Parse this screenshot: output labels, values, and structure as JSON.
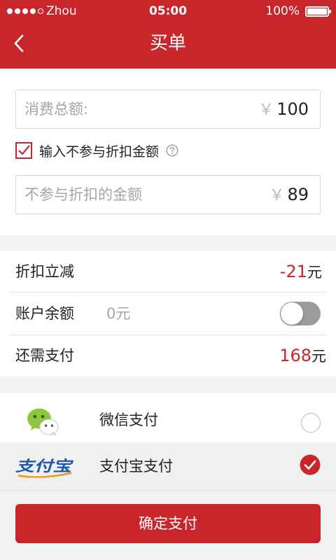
{
  "status_bar": {
    "carrier": "Zhou",
    "time": "05:00",
    "battery": "100%"
  },
  "nav": {
    "title": "买单"
  },
  "amount_form": {
    "total_field": {
      "label": "消费总额:",
      "currency": "￥",
      "value": "100"
    },
    "exclude_checkbox": {
      "label": "输入不参与折扣金额",
      "checked": true
    },
    "exclude_field": {
      "placeholder": "不参与折扣的金额",
      "currency": "￥",
      "value": "89"
    }
  },
  "summary": {
    "discount": {
      "label": "折扣立减",
      "value": "-21",
      "unit": "元"
    },
    "balance": {
      "label": "账户余额",
      "value": "0元",
      "toggle_on": false
    },
    "due": {
      "label": "还需支付",
      "value": "168",
      "unit": "元"
    }
  },
  "payment": {
    "methods": [
      {
        "name": "微信支付",
        "selected": false,
        "icon": "wechat-logo"
      },
      {
        "name": "支付宝支付",
        "selected": true,
        "icon": "alipay-logo",
        "logo_text": "支付宝"
      }
    ]
  },
  "confirm": {
    "label": "确定支付"
  },
  "colors": {
    "accent": "#c9262c",
    "background": "#f2f2f2",
    "wechat_green": "#8dc63f",
    "alipay_blue": "#1d5aa8",
    "alipay_orange": "#f39a1e"
  }
}
